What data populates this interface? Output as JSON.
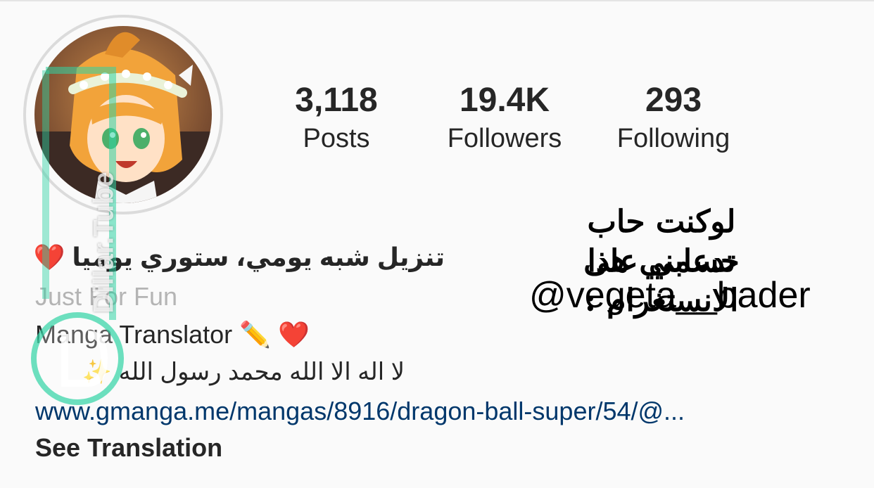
{
  "stats": {
    "posts": {
      "value": "3,118",
      "label": "Posts"
    },
    "followers": {
      "value": "19.4K",
      "label": "Followers"
    },
    "following": {
      "value": "293",
      "label": "Following"
    }
  },
  "bio": {
    "name": "تنزيل شبه يومي، ستوري يوميا",
    "name_emoji": "❤️",
    "category": "Just For Fun",
    "title": "Manga Translator",
    "title_emojis": "✏️",
    "title_heart": "❤️",
    "shahada": "لا اله الا الله محمد رسول الله",
    "shahada_emoji": "✨",
    "link": "www.gmanga.me/mangas/8916/dragon-ball-super/54/@...",
    "see_translation": "See Translation"
  },
  "overlay": {
    "line1": "لوكنت حاب تدعمني هذا",
    "line2": "حسابي على الانستغرام :",
    "handle": "@vegeta__bader"
  },
  "watermark": {
    "text": "Dillar.Tube"
  },
  "colors": {
    "background": "#fafafa",
    "link": "#00376b",
    "category": "#b4b4b4",
    "text": "#262626",
    "heart": "#e0245e",
    "watermark_accent": "#2fd3a4"
  },
  "icons": {
    "avatar": "anime-girl-avatar",
    "watermark_logo": "dillar-tube-logo"
  }
}
